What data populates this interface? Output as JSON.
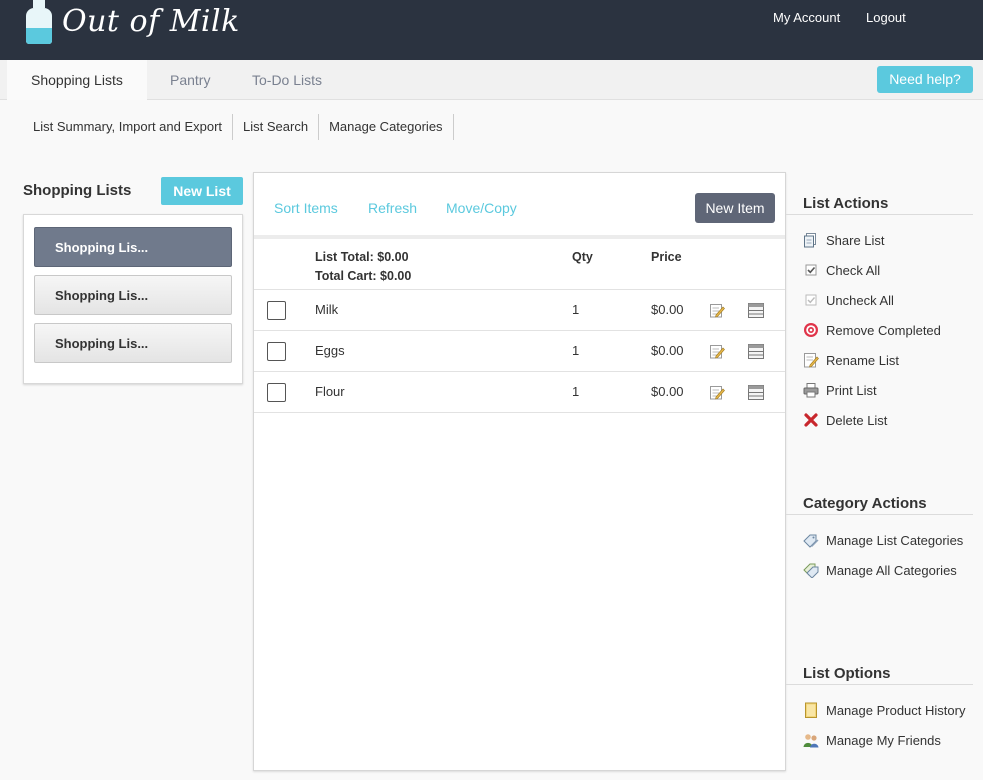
{
  "header": {
    "brand": "Out of Milk",
    "links": {
      "account": "My Account",
      "logout": "Logout"
    }
  },
  "tabs": [
    {
      "label": "Shopping Lists",
      "active": true
    },
    {
      "label": "Pantry"
    },
    {
      "label": "To-Do Lists"
    }
  ],
  "help_label": "Need help?",
  "subnav": [
    "List Summary, Import and Export",
    "List Search",
    "Manage Categories"
  ],
  "sidebar": {
    "title": "Shopping Lists",
    "new_list_label": "New List",
    "lists": [
      {
        "label": "Shopping Lis...",
        "active": true
      },
      {
        "label": "Shopping Lis..."
      },
      {
        "label": "Shopping Lis..."
      }
    ]
  },
  "toolbar": {
    "sort": "Sort Items",
    "refresh": "Refresh",
    "move": "Move/Copy",
    "new_item": "New Item"
  },
  "table": {
    "list_total": "List Total: $0.00",
    "total_cart": "Total Cart: $0.00",
    "qty_header": "Qty",
    "price_header": "Price",
    "rows": [
      {
        "name": "Milk",
        "qty": "1",
        "price": "$0.00"
      },
      {
        "name": "Eggs",
        "qty": "1",
        "price": "$0.00"
      },
      {
        "name": "Flour",
        "qty": "1",
        "price": "$0.00"
      }
    ]
  },
  "list_actions": {
    "title": "List Actions",
    "items": [
      {
        "label": "Share List",
        "icon": "share-icon"
      },
      {
        "label": "Check All",
        "icon": "check-all-icon"
      },
      {
        "label": "Uncheck All",
        "icon": "uncheck-all-icon"
      },
      {
        "label": "Remove Completed",
        "icon": "target-icon"
      },
      {
        "label": "Rename List",
        "icon": "rename-icon"
      },
      {
        "label": "Print List",
        "icon": "printer-icon"
      },
      {
        "label": "Delete List",
        "icon": "delete-icon"
      }
    ]
  },
  "category_actions": {
    "title": "Category Actions",
    "items": [
      {
        "label": "Manage List Categories",
        "icon": "tag-edit-icon"
      },
      {
        "label": "Manage All Categories",
        "icon": "tags-icon"
      }
    ]
  },
  "list_options": {
    "title": "List Options",
    "items": [
      {
        "label": "Manage Product History",
        "icon": "history-icon"
      },
      {
        "label": "Manage My Friends",
        "icon": "friends-icon"
      }
    ]
  },
  "colors": {
    "header_bg": "#2b3340",
    "accent": "#5bc9de",
    "active_list": "#707a8c",
    "new_item_btn": "#5f6677"
  }
}
